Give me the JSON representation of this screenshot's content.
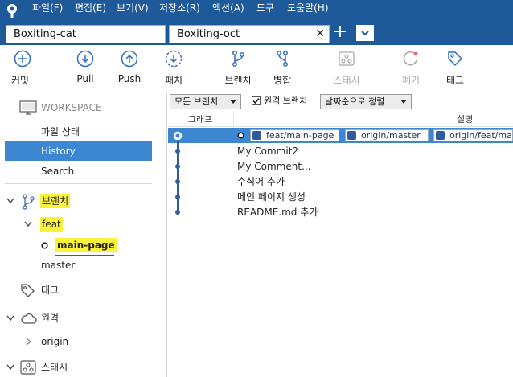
{
  "menu": [
    "파일(F)",
    "편집(E)",
    "보기(V)",
    "저장소(R)",
    "액션(A)",
    "도구",
    "도움말(H)"
  ],
  "tabs": [
    {
      "label": "Boxiting-cat",
      "active": false
    },
    {
      "label": "Boxiting-oct",
      "active": true
    }
  ],
  "tab_add_label": "+",
  "toolbar": [
    {
      "label": "커밋",
      "icon": "plus-circle-icon",
      "enabled": true
    },
    {
      "label": "Pull",
      "icon": "arrow-down-circle-icon",
      "enabled": true
    },
    {
      "label": "Push",
      "icon": "arrow-up-circle-icon",
      "enabled": true
    },
    {
      "label": "패치",
      "icon": "fetch-dashed-circle-icon",
      "enabled": true
    },
    {
      "label": "브랜치",
      "icon": "branch-icon",
      "enabled": true
    },
    {
      "label": "병합",
      "icon": "merge-icon",
      "enabled": true
    },
    {
      "label": "스태시",
      "icon": "stash-icon",
      "enabled": false
    },
    {
      "label": "폐기",
      "icon": "discard-icon",
      "enabled": false
    },
    {
      "label": "태그",
      "icon": "tag-icon",
      "enabled": true
    }
  ],
  "sidebar": {
    "workspace_title": "WORKSPACE",
    "workspace_items": [
      "파일 상태",
      "History",
      "Search"
    ],
    "selected_item": "History",
    "branches_title": "브랜치",
    "branch_folder": "feat",
    "current_branch": "main-page",
    "other_branch": "master",
    "tags_title": "태그",
    "remotes_title": "원격",
    "remote_item": "origin",
    "stash_title": "스태시"
  },
  "filters": {
    "branch_dropdown": "모든 브랜치",
    "remote_branches_label": "원격 브랜치",
    "remote_branches_checked": true,
    "sort_dropdown": "날짜순으로 정렬"
  },
  "columns": {
    "graph": "그래프",
    "description": "설명"
  },
  "commits": [
    {
      "message": "",
      "refs": [
        "feat/main-page",
        "origin/master",
        "origin/feat/main-page"
      ],
      "selected": true
    },
    {
      "message": "My Commit2",
      "refs": []
    },
    {
      "message": "My Comment...",
      "refs": []
    },
    {
      "message": "수식어 추가",
      "refs": []
    },
    {
      "message": "메인 페이지 생성",
      "refs": []
    },
    {
      "message": "README.md 추가",
      "refs": []
    }
  ],
  "colors": {
    "titlebar": "#1e5a9a",
    "selection": "#3d86d1",
    "icon_blue": "#2d6fc0",
    "highlight": "#fbf33a",
    "underline": "#e31b1b"
  }
}
